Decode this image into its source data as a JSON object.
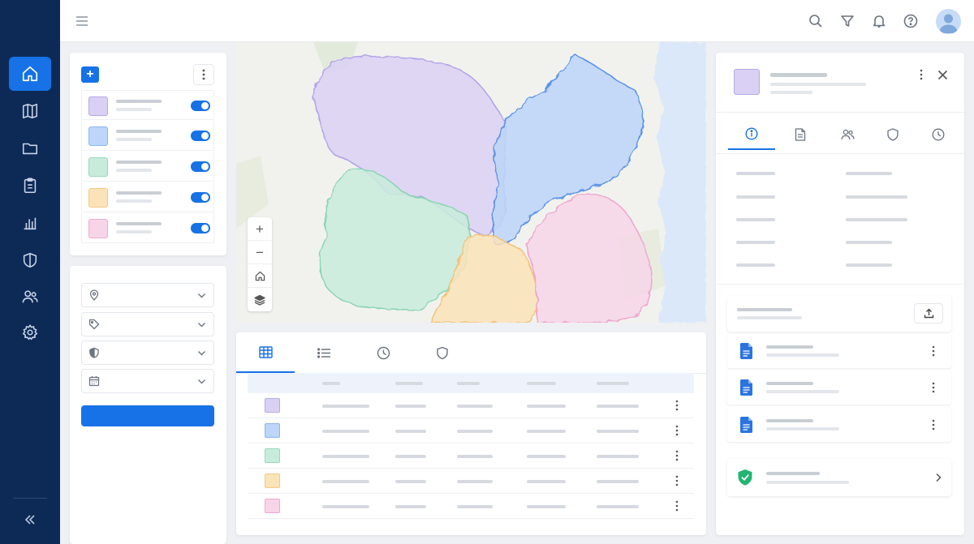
{
  "nav": {
    "items": [
      {
        "icon": "home-icon",
        "active": true
      },
      {
        "icon": "map-icon",
        "active": false
      },
      {
        "icon": "folder-icon",
        "active": false
      },
      {
        "icon": "clipboard-icon",
        "active": false
      },
      {
        "icon": "bar-chart-icon",
        "active": false
      },
      {
        "icon": "shield-icon",
        "active": false
      },
      {
        "icon": "users-icon",
        "active": false
      },
      {
        "icon": "settings-icon",
        "active": false
      }
    ],
    "collapse_icon": "collapse-chevrons-icon"
  },
  "topbar": {
    "icons": [
      "hamburger-menu-icon",
      "search-icon",
      "filter-icon",
      "bell-icon",
      "help-icon",
      "avatar"
    ]
  },
  "layers": {
    "add_label": "+",
    "items": [
      {
        "swatch": "purple",
        "enabled": true
      },
      {
        "swatch": "blue",
        "enabled": true
      },
      {
        "swatch": "green",
        "enabled": true
      },
      {
        "swatch": "orange",
        "enabled": true
      },
      {
        "swatch": "pink",
        "enabled": true
      }
    ]
  },
  "filters": {
    "fields": [
      {
        "icon": "location-pin-icon"
      },
      {
        "icon": "tag-icon"
      },
      {
        "icon": "shield-half-icon"
      },
      {
        "icon": "calendar-icon"
      }
    ]
  },
  "map": {
    "zoom_in_label": "+",
    "zoom_out_label": "−",
    "regions": [
      "purple",
      "blue",
      "green",
      "orange",
      "pink"
    ]
  },
  "table": {
    "tabs": [
      {
        "icon": "grid-table-icon",
        "active": true
      },
      {
        "icon": "list-icon",
        "active": false
      },
      {
        "icon": "clock-icon",
        "active": false
      },
      {
        "icon": "shield-icon",
        "active": false
      }
    ],
    "rows": [
      "purple",
      "blue",
      "green",
      "orange",
      "pink"
    ]
  },
  "details": {
    "tabs": [
      {
        "icon": "info-icon",
        "active": true
      },
      {
        "icon": "document-icon",
        "active": false
      },
      {
        "icon": "users-icon",
        "active": false
      },
      {
        "icon": "shield-icon",
        "active": false
      },
      {
        "icon": "clock-icon",
        "active": false
      }
    ],
    "documents": [
      {
        "icon": "doc-file-icon"
      },
      {
        "icon": "doc-file-icon"
      },
      {
        "icon": "doc-file-icon"
      }
    ],
    "status": {
      "icon": "verified-shield-icon"
    }
  },
  "colors": {
    "accent": "#1672e6",
    "nav_bg": "#0d2a57",
    "purple": "#d9d0f4",
    "blue": "#bcd5f8",
    "green": "#c8ecdc",
    "orange": "#fbe3b8",
    "pink": "#f8d4e8",
    "verified": "#22b573"
  }
}
